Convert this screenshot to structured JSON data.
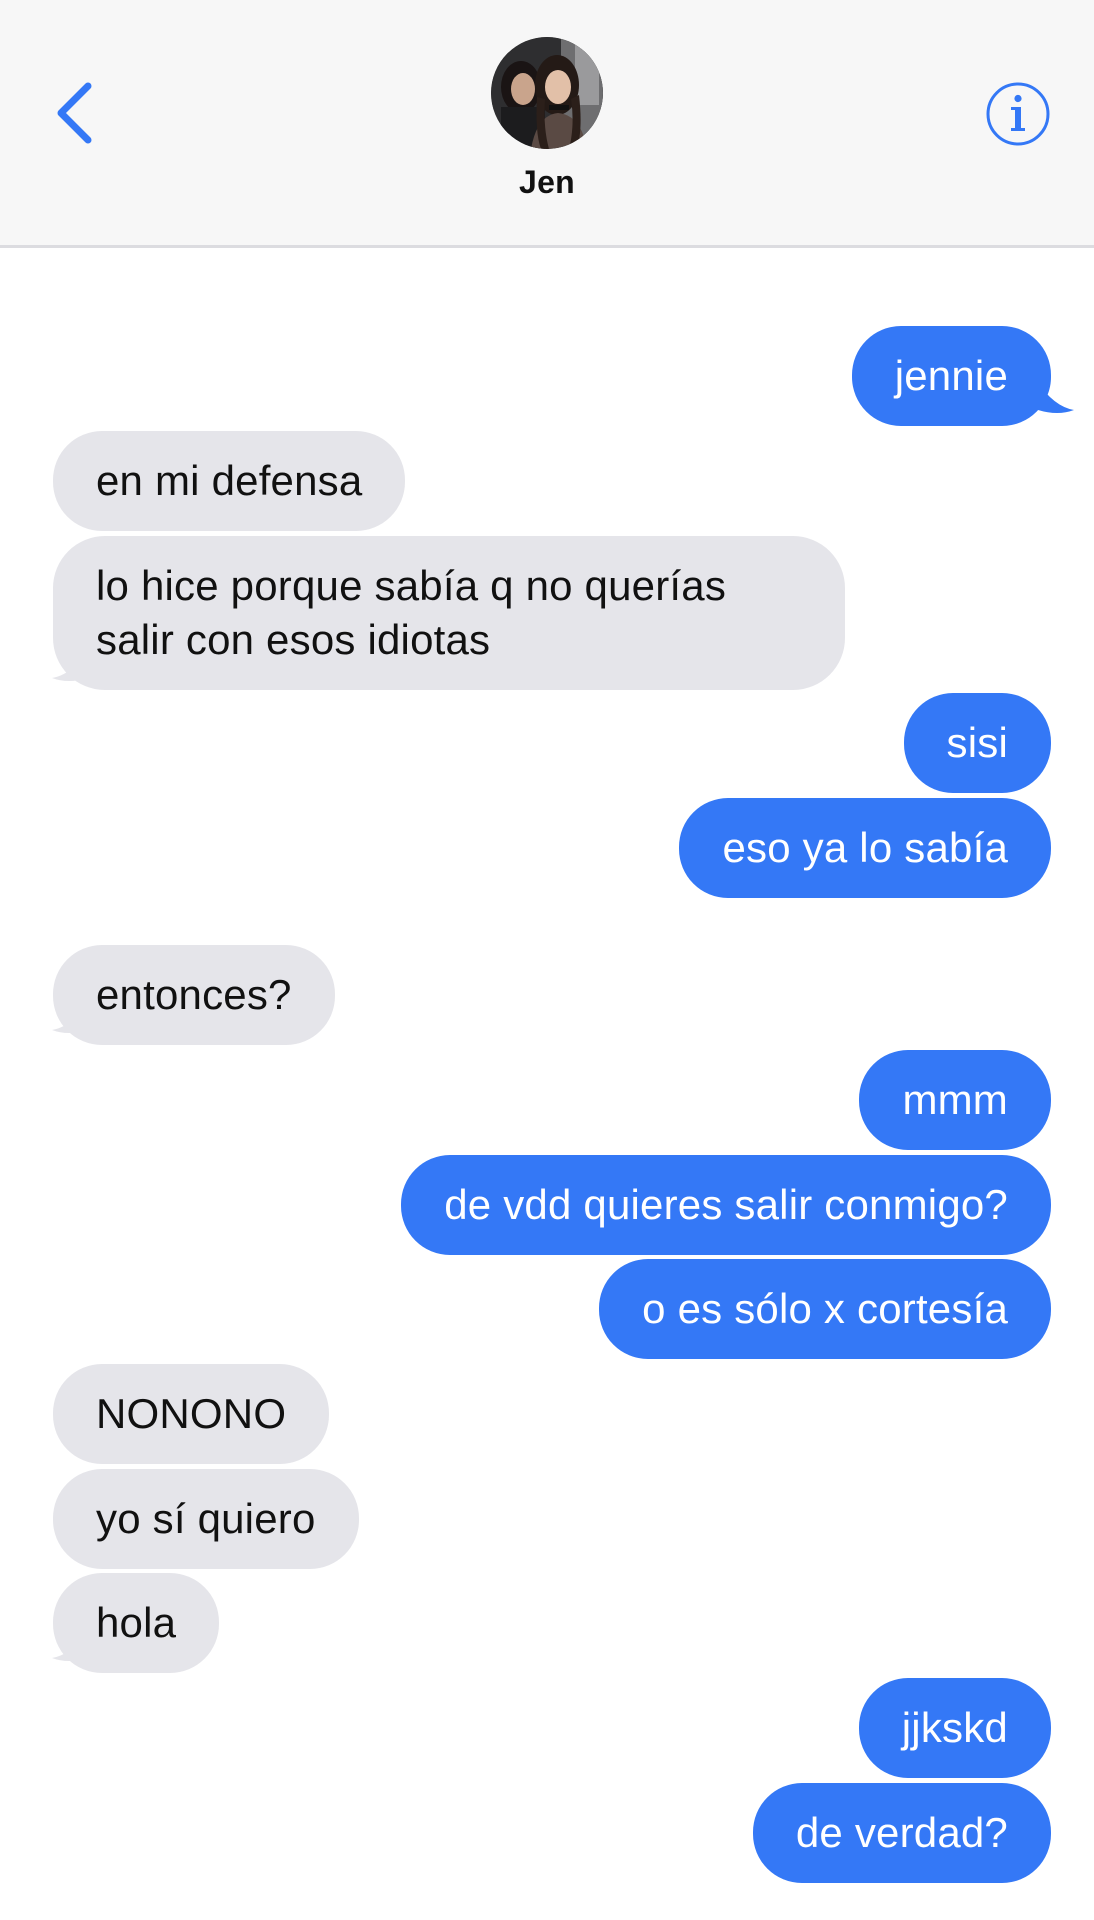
{
  "header": {
    "contact_name": "Jen",
    "back_icon": "chevron-left-icon",
    "info_icon": "info-circle-icon",
    "accent_color": "#3478f6"
  },
  "colors": {
    "outgoing_bubble": "#3478f6",
    "incoming_bubble": "#e5e5ea",
    "header_background": "#f7f7f7"
  },
  "messages": [
    {
      "direction": "outgoing",
      "text": "jennie"
    },
    {
      "direction": "incoming",
      "text": "en mi defensa"
    },
    {
      "direction": "incoming",
      "text": "lo hice porque sabía q no querías salir con esos idiotas"
    },
    {
      "direction": "outgoing",
      "text": "sisi"
    },
    {
      "direction": "outgoing",
      "text": "eso ya lo sabía"
    },
    {
      "direction": "incoming",
      "text": "entonces?"
    },
    {
      "direction": "outgoing",
      "text": "mmm"
    },
    {
      "direction": "outgoing",
      "text": "de vdd quieres salir conmigo?"
    },
    {
      "direction": "outgoing",
      "text": "o es sólo x cortesía"
    },
    {
      "direction": "incoming",
      "text": "NONONO"
    },
    {
      "direction": "incoming",
      "text": "yo sí quiero"
    },
    {
      "direction": "incoming",
      "text": "hola"
    },
    {
      "direction": "outgoing",
      "text": "jjkskd"
    },
    {
      "direction": "outgoing",
      "text": "de verdad?"
    }
  ]
}
